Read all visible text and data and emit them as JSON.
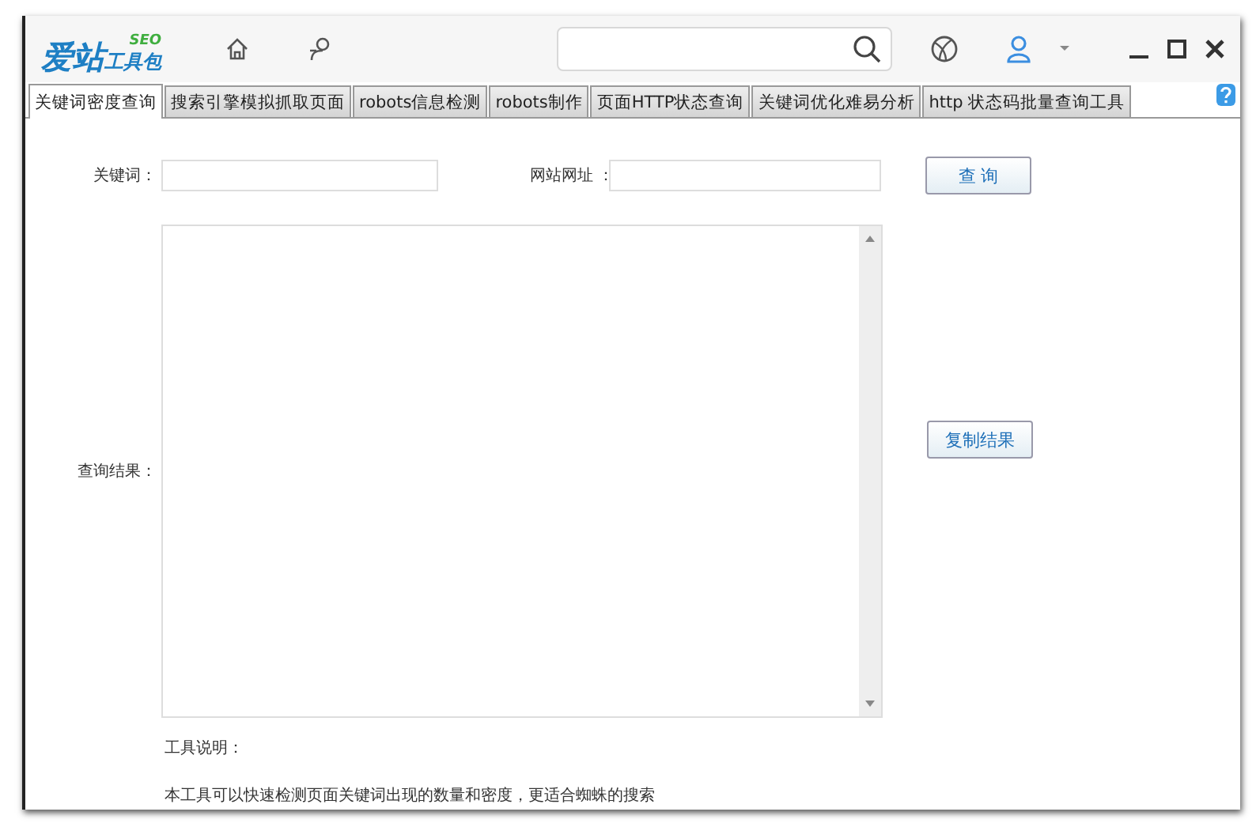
{
  "logo": {
    "main": "爱站",
    "sub": "工具包",
    "badge": "SEO"
  },
  "tabs": [
    {
      "label": "关键词密度查询",
      "selected": true
    },
    {
      "label": "搜索引擎模拟抓取页面",
      "selected": false
    },
    {
      "label": "robots信息检测",
      "selected": false
    },
    {
      "label": "robots制作",
      "selected": false
    },
    {
      "label": "页面HTTP状态查询",
      "selected": false
    },
    {
      "label": "关键词优化难易分析",
      "selected": false
    },
    {
      "label": "http 状态码批量查询工具",
      "selected": false
    }
  ],
  "form": {
    "keyword_label": "关键词：",
    "url_label": "网站网址 ：",
    "query_button": "查 询",
    "result_label": "查询结果：",
    "copy_button": "复制结果"
  },
  "notes": {
    "title": "工具说明：",
    "text": "本工具可以快速检测页面关键词出现的数量和密度，更适合蜘蛛的搜索"
  }
}
